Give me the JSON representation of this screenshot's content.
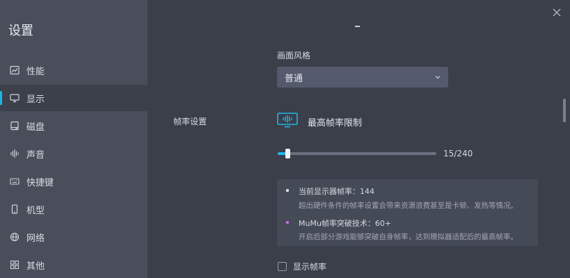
{
  "sidebar": {
    "title": "设置",
    "items": [
      {
        "label": "性能",
        "icon": "chart-icon"
      },
      {
        "label": "显示",
        "icon": "monitor-icon"
      },
      {
        "label": "磁盘",
        "icon": "disk-icon"
      },
      {
        "label": "声音",
        "icon": "sound-icon"
      },
      {
        "label": "快捷键",
        "icon": "keyboard-icon"
      },
      {
        "label": "机型",
        "icon": "phone-icon"
      },
      {
        "label": "网络",
        "icon": "globe-icon"
      },
      {
        "label": "其他",
        "icon": "grid-icon"
      }
    ],
    "active_index": 1
  },
  "display": {
    "style_label": "画面风格",
    "style_value": "普通",
    "fps_section_label": "帧率设置",
    "fps_limit_title": "最高帧率限制",
    "fps_current": 15,
    "fps_max": 240,
    "fps_value_text": "15/240",
    "info": {
      "line1_title": "当前显示器帧率：144",
      "line1_desc": "超出硬件条件的帧率设置会带来资源浪费甚至是卡顿、发热等情况。",
      "line2_title": "MuMu帧率突破技术：60+",
      "line2_desc": "开启后部分游戏能够突破自身帧率，达到模拟器适配后的最高帧率。"
    },
    "show_fps_label": "显示帧率",
    "show_fps_checked": false
  },
  "colors": {
    "accent": "#1fb7e6",
    "bullet_white": "#d9dce3",
    "bullet_purple": "#c46be0"
  }
}
